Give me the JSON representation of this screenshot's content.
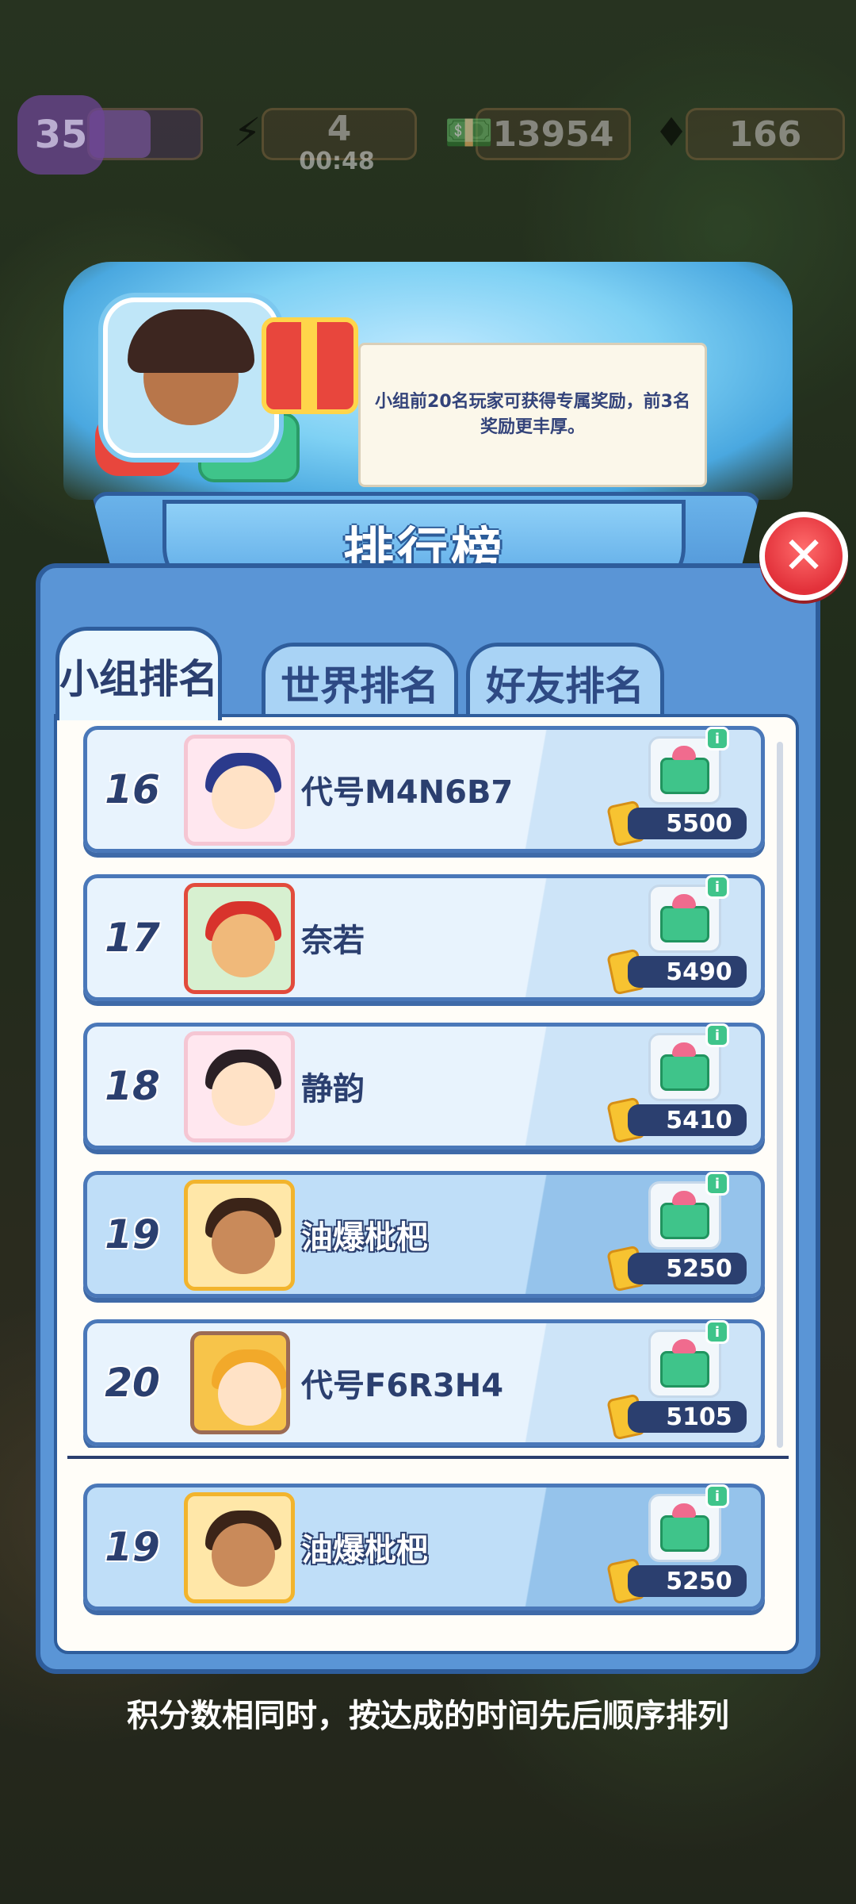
{
  "hud": {
    "level": "35",
    "xp_fraction": 0.55,
    "energy": "4",
    "energy_timer": "00:48",
    "cash": "13954",
    "gems": "166"
  },
  "banner": {
    "tooltip": "小组前20名玩家可获得专属奖励，前3名奖励更丰厚。",
    "title": "排行榜"
  },
  "tabs": [
    {
      "label": "小组排名",
      "active": true
    },
    {
      "label": "世界排名",
      "active": false
    },
    {
      "label": "好友排名",
      "active": false
    }
  ],
  "rows": [
    {
      "rank": "16",
      "name": "代号M4N6B7",
      "score": "5500"
    },
    {
      "rank": "17",
      "name": "奈若",
      "score": "5490"
    },
    {
      "rank": "18",
      "name": "静韵",
      "score": "5410"
    },
    {
      "rank": "19",
      "name": "油爆枇杷",
      "score": "5250"
    },
    {
      "rank": "20",
      "name": "代号F6R3H4",
      "score": "5105"
    }
  ],
  "self_row": {
    "rank": "19",
    "name": "油爆枇杷",
    "score": "5250"
  },
  "footer_note": "积分数相同时，按达成的时间先后顺序排列",
  "colors": {
    "panel": "#5a95d6",
    "panel_border": "#2e5d9c",
    "close_button": "#e2313a",
    "text_dark": "#2b3f6f"
  }
}
